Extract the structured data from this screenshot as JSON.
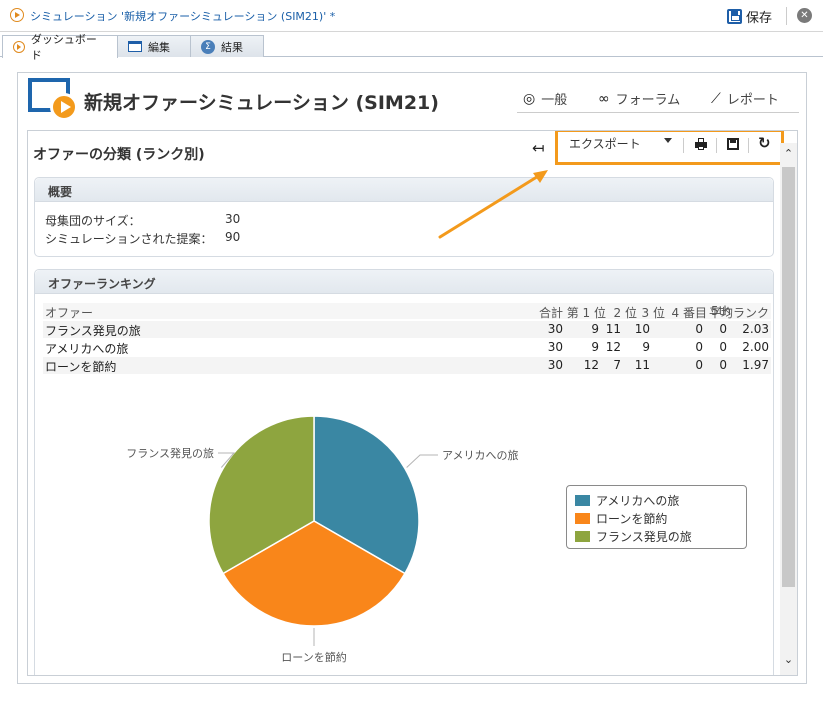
{
  "window": {
    "title": "シミュレーション '新規オファーシミュレーション (SIM21)' *",
    "save_label": "保存",
    "close_glyph": "✕"
  },
  "tabs": [
    {
      "label": "ダッシュボード",
      "icon": "play-circle-icon",
      "active": true
    },
    {
      "label": "編集",
      "icon": "edit-window-icon",
      "active": false
    },
    {
      "label": "結果",
      "icon": "sigma-icon",
      "active": false
    }
  ],
  "header": {
    "title": "新規オファーシミュレーション (SIM21)",
    "nav": [
      {
        "label": "一般",
        "icon": "gauge-icon",
        "glyph": "◎"
      },
      {
        "label": "フォーラム",
        "icon": "link-icon",
        "glyph": "∞"
      },
      {
        "label": "レポート",
        "icon": "line-chart-icon",
        "glyph": "⟋"
      }
    ]
  },
  "report": {
    "section_title": "オファーの分類 (ランク別)",
    "back_glyph": "↤",
    "export_label": "エクスポート",
    "refresh_glyph": "↻"
  },
  "summary": {
    "heading": "概要",
    "rows": [
      {
        "label": "母集団のサイズ：",
        "value": "30"
      },
      {
        "label": "シミュレーションされた提案：",
        "value": "90"
      }
    ]
  },
  "ranking": {
    "heading": "オファーランキング",
    "columns": [
      "オファー",
      "合計",
      "第 1 位",
      "2 位",
      "3 位",
      "4 番目",
      "5th",
      "平均ランク"
    ],
    "rows": [
      [
        "フランス発見の旅",
        "30",
        "9",
        "11",
        "10",
        "0",
        "0",
        "2.03"
      ],
      [
        "アメリカへの旅",
        "30",
        "9",
        "12",
        "9",
        "0",
        "0",
        "2.00"
      ],
      [
        "ローンを節約",
        "30",
        "12",
        "7",
        "11",
        "0",
        "0",
        "1.97"
      ]
    ]
  },
  "chart_data": {
    "type": "pie",
    "title": "",
    "slices": [
      {
        "label": "アメリカへの旅",
        "value": 30,
        "color": "#3a87a3"
      },
      {
        "label": "ローンを節約",
        "value": 30,
        "color": "#f9861a"
      },
      {
        "label": "フランス発見の旅",
        "value": 30,
        "color": "#8ea53f"
      }
    ],
    "legend_placement": "right"
  },
  "colors": {
    "accent_orange": "#f39a1c",
    "link_blue": "#1a5fa8"
  }
}
